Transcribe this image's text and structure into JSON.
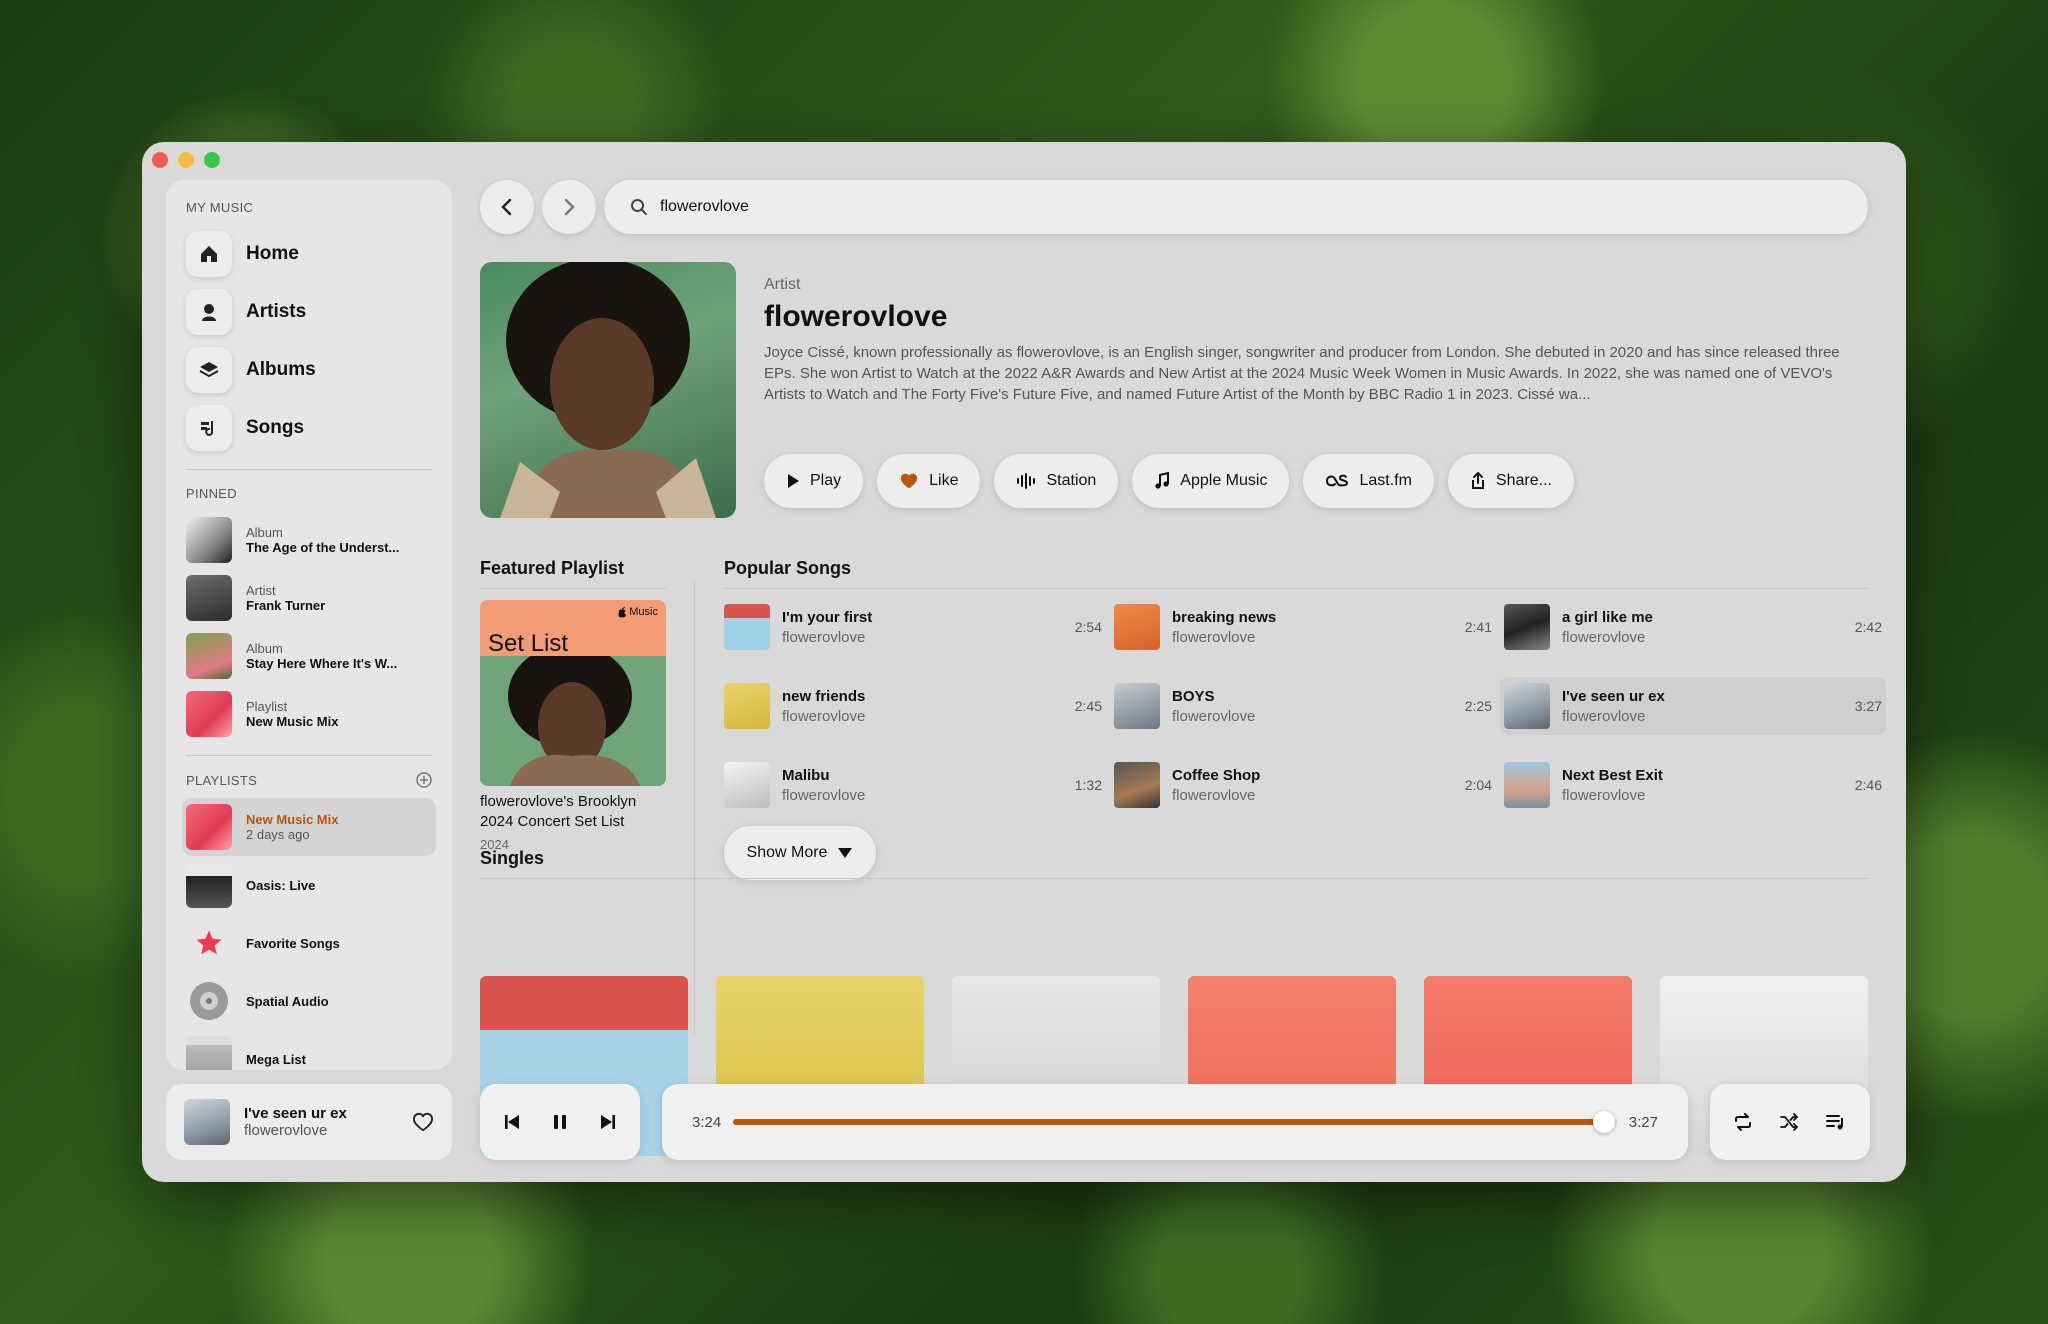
{
  "sidebar": {
    "my_music_title": "MY MUSIC",
    "nav": [
      {
        "label": "Home",
        "icon": "home-icon"
      },
      {
        "label": "Artists",
        "icon": "artist-icon"
      },
      {
        "label": "Albums",
        "icon": "albums-icon"
      },
      {
        "label": "Songs",
        "icon": "songs-icon"
      }
    ],
    "pinned_title": "PINNED",
    "pinned": [
      {
        "kind": "Album",
        "name": "The Age of the Underst..."
      },
      {
        "kind": "Artist",
        "name": "Frank Turner"
      },
      {
        "kind": "Album",
        "name": "Stay Here Where It's W..."
      },
      {
        "kind": "Playlist",
        "name": "New Music Mix"
      }
    ],
    "playlists_title": "PLAYLISTS",
    "playlists": [
      {
        "name": "New Music Mix",
        "sub": "2 days ago"
      },
      {
        "name": "Oasis: Live",
        "sub": ""
      },
      {
        "name": "Favorite Songs",
        "sub": ""
      },
      {
        "name": "Spatial Audio",
        "sub": ""
      },
      {
        "name": "Mega List",
        "sub": ""
      }
    ]
  },
  "now_playing": {
    "title": "I've seen ur ex",
    "artist": "flowerovlove"
  },
  "search": {
    "value": "flowerovlove"
  },
  "artist": {
    "kind": "Artist",
    "name": "flowerovlove",
    "bio": "Joyce Cissé, known professionally as flowerovlove, is an English singer, songwriter and producer from London. She debuted in 2020 and has since released three EPs. She won Artist to Watch at the 2022 A&R Awards and New Artist at the 2024 Music Week Women in Music Awards. In 2022, she was named one of VEVO's Artists to Watch and The Forty Five's Future Five, and named Future Artist of the Month by BBC Radio 1 in 2023. Cissé wa..."
  },
  "actions": {
    "play": "Play",
    "like": "Like",
    "station": "Station",
    "apple_music": "Apple Music",
    "lastfm": "Last.fm",
    "share": "Share..."
  },
  "featured": {
    "heading": "Featured Playlist",
    "cover_title": "Set List",
    "cover_brand": "Music",
    "title": "flowerovlove's Brooklyn 2024 Concert Set List",
    "year": "2024"
  },
  "popular": {
    "heading": "Popular Songs",
    "songs": [
      {
        "title": "I'm your first",
        "artist": "flowerovlove",
        "duration": "2:54"
      },
      {
        "title": "breaking news",
        "artist": "flowerovlove",
        "duration": "2:41"
      },
      {
        "title": "a girl like me",
        "artist": "flowerovlove",
        "duration": "2:42"
      },
      {
        "title": "new friends",
        "artist": "flowerovlove",
        "duration": "2:45"
      },
      {
        "title": "BOYS",
        "artist": "flowerovlove",
        "duration": "2:25"
      },
      {
        "title": "I've seen ur ex",
        "artist": "flowerovlove",
        "duration": "3:27"
      },
      {
        "title": "Malibu",
        "artist": "flowerovlove",
        "duration": "1:32"
      },
      {
        "title": "Coffee Shop",
        "artist": "flowerovlove",
        "duration": "2:04"
      },
      {
        "title": "Next Best Exit",
        "artist": "flowerovlove",
        "duration": "2:46"
      }
    ],
    "show_more": "Show More"
  },
  "singles": {
    "heading": "Singles"
  },
  "player": {
    "elapsed": "3:24",
    "total": "3:27",
    "progress": 0.985
  },
  "colors": {
    "accent": "#b8560c",
    "window": "#d9d9d9"
  }
}
